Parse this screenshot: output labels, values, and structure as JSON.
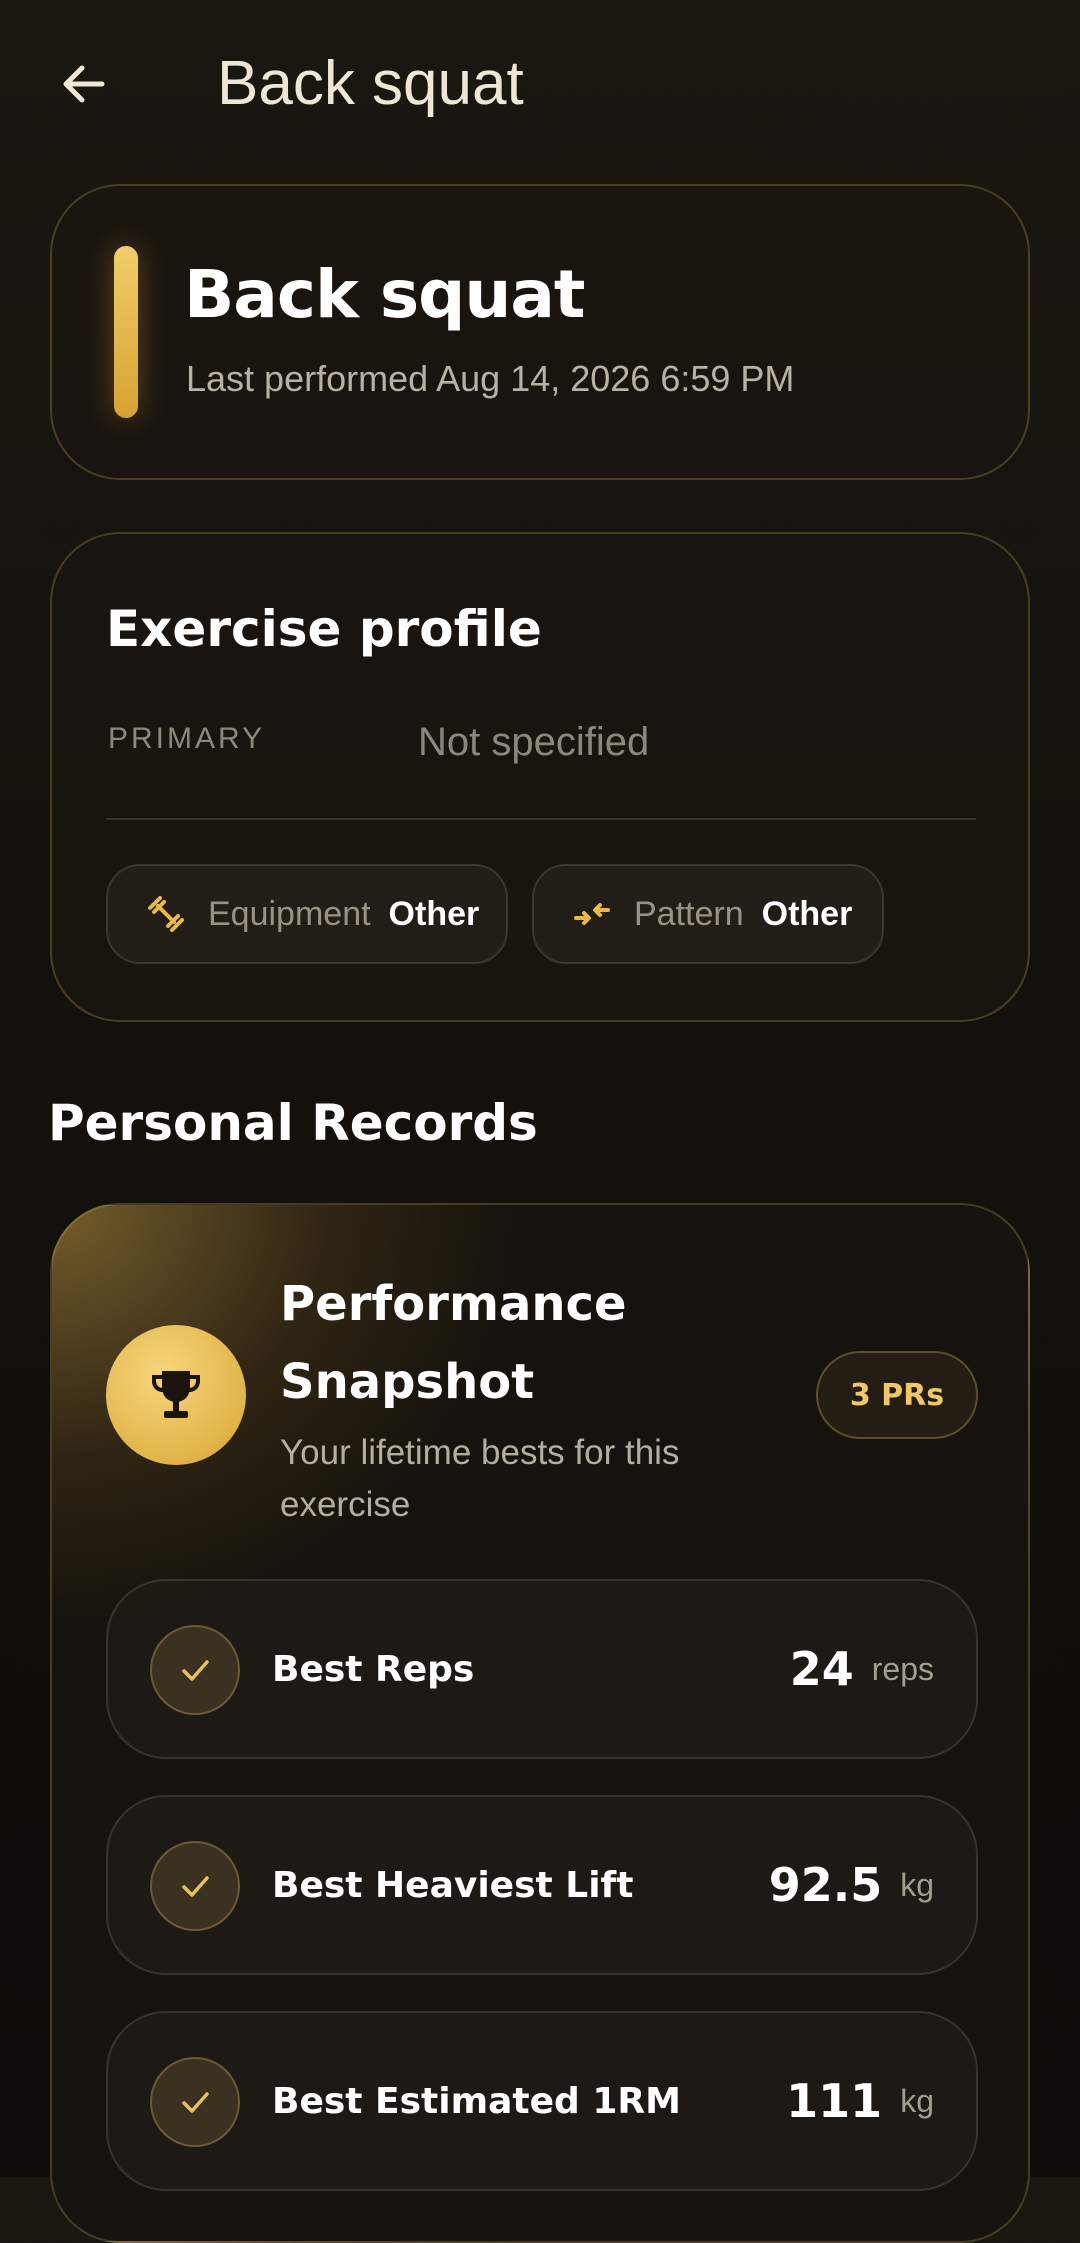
{
  "topbar": {
    "back_icon": "arrow-left-icon",
    "title": "Back squat"
  },
  "header": {
    "exercise_name": "Back squat",
    "last_performed": "Last performed Aug 14, 2026 6:59 PM",
    "accent_color": "#e2b44a"
  },
  "profile": {
    "title": "Exercise profile",
    "primary_label": "PRIMARY",
    "primary_value": "Not specified",
    "chips": [
      {
        "icon": "dumbbell-icon",
        "label": "Equipment",
        "value": "Other"
      },
      {
        "icon": "pattern-arrows-icon",
        "label": "Pattern",
        "value": "Other"
      }
    ]
  },
  "records": {
    "section_title": "Personal Records",
    "snapshot_title": "Performance Snapshot",
    "snapshot_subtitle": "Your lifetime bests for this exercise",
    "trophy_icon": "trophy-icon",
    "badge": "3 PRs",
    "items": [
      {
        "label": "Best Reps",
        "value": "24",
        "unit": "reps"
      },
      {
        "label": "Best Heaviest Lift",
        "value": "92.5",
        "unit": "kg"
      },
      {
        "label": "Best Estimated 1RM",
        "value": "111",
        "unit": "kg"
      }
    ]
  }
}
